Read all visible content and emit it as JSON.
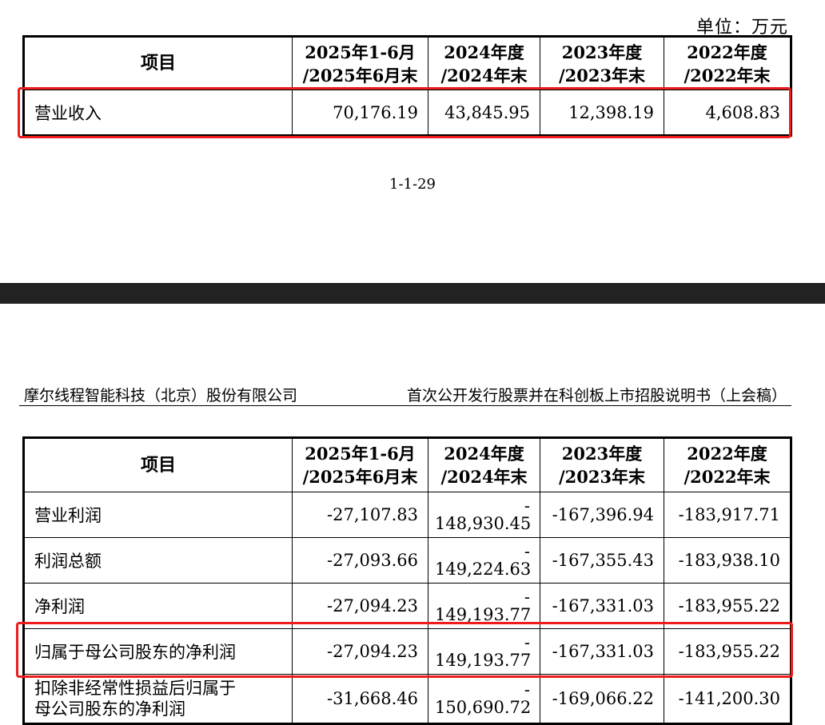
{
  "unit_label": "单位：万元",
  "columns": {
    "item": "项目",
    "c1a": "2025年1-6月",
    "c1b": "/2025年6月末",
    "c2a": "2024年度",
    "c2b": "/2024年末",
    "c3a": "2023年度",
    "c3b": "/2023年末",
    "c4a": "2022年度",
    "c4b": "/2022年末"
  },
  "table1": {
    "revenue": {
      "label": "营业收入",
      "v1": "70,176.19",
      "v2": "43,845.95",
      "v3": "12,398.19",
      "v4": "4,608.83"
    }
  },
  "page_number": "1-1-29",
  "doc_header": {
    "company": "摩尔线程智能科技（北京）股份有限公司",
    "document": "首次公开发行股票并在科创板上市招股说明书（上会稿）"
  },
  "table2": {
    "rows": [
      {
        "label": "营业利润",
        "v1": "-27,107.83",
        "v2_sign": "-",
        "v2": "148,930.45",
        "v3": "-167,396.94",
        "v4": "-183,917.71"
      },
      {
        "label": "利润总额",
        "v1": "-27,093.66",
        "v2_sign": "-",
        "v2": "149,224.63",
        "v3": "-167,355.43",
        "v4": "-183,938.10"
      },
      {
        "label": "净利润",
        "v1": "-27,094.23",
        "v2_sign": "-",
        "v2": "149,193.77",
        "v3": "-167,331.03",
        "v4": "-183,955.22"
      },
      {
        "label": "归属于母公司股东的净利润",
        "v1": "-27,094.23",
        "v2_sign": "-",
        "v2": "149,193.77",
        "v3": "-167,331.03",
        "v4": "-183,955.22"
      },
      {
        "label_line1": "扣除非经常性损益后归属于",
        "label_line2": "母公司股东的净利润",
        "v1": "-31,668.46",
        "v2_sign": "-",
        "v2": "150,690.72",
        "v3": "-169,066.22",
        "v4": "-141,200.30"
      }
    ]
  },
  "highlight_color": "#ee1c1c"
}
